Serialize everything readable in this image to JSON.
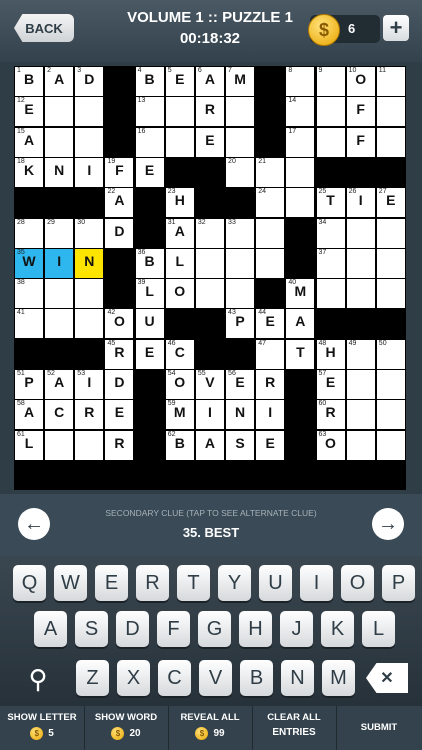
{
  "header": {
    "back_label": "BACK",
    "title": "VOLUME 1 :: PUZZLE 1",
    "timer": "00:18:32",
    "coins": "6",
    "coin_symbol": "$",
    "plus_label": "+"
  },
  "grid": {
    "rows": 14,
    "cols": 13,
    "cells": [
      {
        "r": 0,
        "c": 0,
        "n": "1",
        "l": "B"
      },
      {
        "r": 0,
        "c": 1,
        "n": "2",
        "l": "A"
      },
      {
        "r": 0,
        "c": 2,
        "n": "3",
        "l": "D"
      },
      {
        "r": 0,
        "c": 4,
        "n": "4",
        "l": "B"
      },
      {
        "r": 0,
        "c": 5,
        "n": "5",
        "l": "E"
      },
      {
        "r": 0,
        "c": 6,
        "n": "6",
        "l": "A"
      },
      {
        "r": 0,
        "c": 7,
        "n": "7",
        "l": "M"
      },
      {
        "r": 0,
        "c": 9,
        "n": "8",
        "l": ""
      },
      {
        "r": 0,
        "c": 10,
        "n": "9",
        "l": ""
      },
      {
        "r": 0,
        "c": 11,
        "n": "10",
        "l": "O"
      },
      {
        "r": 0,
        "c": 12,
        "n": "11",
        "l": ""
      },
      {
        "r": 1,
        "c": 0,
        "n": "12",
        "l": "E"
      },
      {
        "r": 1,
        "c": 1,
        "n": "",
        "l": ""
      },
      {
        "r": 1,
        "c": 2,
        "n": "",
        "l": ""
      },
      {
        "r": 1,
        "c": 4,
        "n": "13",
        "l": ""
      },
      {
        "r": 1,
        "c": 5,
        "n": "",
        "l": ""
      },
      {
        "r": 1,
        "c": 6,
        "n": "",
        "l": "R"
      },
      {
        "r": 1,
        "c": 7,
        "n": "",
        "l": ""
      },
      {
        "r": 1,
        "c": 9,
        "n": "14",
        "l": ""
      },
      {
        "r": 1,
        "c": 10,
        "n": "",
        "l": ""
      },
      {
        "r": 1,
        "c": 11,
        "n": "",
        "l": "F"
      },
      {
        "r": 1,
        "c": 12,
        "n": "",
        "l": ""
      },
      {
        "r": 2,
        "c": 0,
        "n": "15",
        "l": "A"
      },
      {
        "r": 2,
        "c": 1,
        "n": "",
        "l": ""
      },
      {
        "r": 2,
        "c": 2,
        "n": "",
        "l": ""
      },
      {
        "r": 2,
        "c": 4,
        "n": "16",
        "l": ""
      },
      {
        "r": 2,
        "c": 5,
        "n": "",
        "l": ""
      },
      {
        "r": 2,
        "c": 6,
        "n": "",
        "l": "E"
      },
      {
        "r": 2,
        "c": 7,
        "n": "",
        "l": ""
      },
      {
        "r": 2,
        "c": 9,
        "n": "17",
        "l": ""
      },
      {
        "r": 2,
        "c": 10,
        "n": "",
        "l": ""
      },
      {
        "r": 2,
        "c": 11,
        "n": "",
        "l": "F"
      },
      {
        "r": 2,
        "c": 12,
        "n": "",
        "l": ""
      },
      {
        "r": 3,
        "c": 0,
        "n": "18",
        "l": "K"
      },
      {
        "r": 3,
        "c": 1,
        "n": "",
        "l": "N"
      },
      {
        "r": 3,
        "c": 2,
        "n": "",
        "l": "I"
      },
      {
        "r": 3,
        "c": 3,
        "n": "19",
        "l": "F"
      },
      {
        "r": 3,
        "c": 4,
        "n": "",
        "l": "E"
      },
      {
        "r": 3,
        "c": 7,
        "n": "20",
        "l": ""
      },
      {
        "r": 3,
        "c": 8,
        "n": "21",
        "l": ""
      },
      {
        "r": 3,
        "c": 9,
        "n": "",
        "l": ""
      },
      {
        "r": 4,
        "c": 3,
        "n": "22",
        "l": "A"
      },
      {
        "r": 4,
        "c": 5,
        "n": "23",
        "l": "H"
      },
      {
        "r": 4,
        "c": 8,
        "n": "24",
        "l": ""
      },
      {
        "r": 4,
        "c": 9,
        "n": "",
        "l": ""
      },
      {
        "r": 4,
        "c": 10,
        "n": "25",
        "l": "T"
      },
      {
        "r": 4,
        "c": 11,
        "n": "26",
        "l": "I"
      },
      {
        "r": 4,
        "c": 12,
        "n": "27",
        "l": "E"
      },
      {
        "r": 5,
        "c": 0,
        "n": "28",
        "l": ""
      },
      {
        "r": 5,
        "c": 1,
        "n": "29",
        "l": ""
      },
      {
        "r": 5,
        "c": 2,
        "n": "30",
        "l": ""
      },
      {
        "r": 5,
        "c": 3,
        "n": "",
        "l": "D"
      },
      {
        "r": 5,
        "c": 5,
        "n": "31",
        "l": "A"
      },
      {
        "r": 5,
        "c": 6,
        "n": "32",
        "l": ""
      },
      {
        "r": 5,
        "c": 7,
        "n": "33",
        "l": ""
      },
      {
        "r": 5,
        "c": 8,
        "n": "",
        "l": ""
      },
      {
        "r": 5,
        "c": 10,
        "n": "34",
        "l": ""
      },
      {
        "r": 5,
        "c": 11,
        "n": "",
        "l": ""
      },
      {
        "r": 5,
        "c": 12,
        "n": "",
        "l": ""
      },
      {
        "r": 6,
        "c": 0,
        "n": "35",
        "l": "W",
        "s": "hl"
      },
      {
        "r": 6,
        "c": 1,
        "n": "",
        "l": "I",
        "s": "hl"
      },
      {
        "r": 6,
        "c": 2,
        "n": "",
        "l": "N",
        "s": "cur"
      },
      {
        "r": 6,
        "c": 4,
        "n": "36",
        "l": "B"
      },
      {
        "r": 6,
        "c": 5,
        "n": "",
        "l": "L"
      },
      {
        "r": 6,
        "c": 6,
        "n": "",
        "l": ""
      },
      {
        "r": 6,
        "c": 7,
        "n": "",
        "l": ""
      },
      {
        "r": 6,
        "c": 8,
        "n": "",
        "l": ""
      },
      {
        "r": 6,
        "c": 10,
        "n": "37",
        "l": ""
      },
      {
        "r": 6,
        "c": 11,
        "n": "",
        "l": ""
      },
      {
        "r": 6,
        "c": 12,
        "n": "",
        "l": ""
      },
      {
        "r": 7,
        "c": 0,
        "n": "38",
        "l": ""
      },
      {
        "r": 7,
        "c": 1,
        "n": "",
        "l": ""
      },
      {
        "r": 7,
        "c": 2,
        "n": "",
        "l": ""
      },
      {
        "r": 7,
        "c": 4,
        "n": "39",
        "l": "L"
      },
      {
        "r": 7,
        "c": 5,
        "n": "",
        "l": "O"
      },
      {
        "r": 7,
        "c": 6,
        "n": "",
        "l": ""
      },
      {
        "r": 7,
        "c": 7,
        "n": "",
        "l": ""
      },
      {
        "r": 7,
        "c": 9,
        "n": "40",
        "l": "M"
      },
      {
        "r": 7,
        "c": 10,
        "n": "",
        "l": ""
      },
      {
        "r": 7,
        "c": 11,
        "n": "",
        "l": ""
      },
      {
        "r": 7,
        "c": 12,
        "n": "",
        "l": ""
      },
      {
        "r": 8,
        "c": 0,
        "n": "41",
        "l": ""
      },
      {
        "r": 8,
        "c": 1,
        "n": "",
        "l": ""
      },
      {
        "r": 8,
        "c": 2,
        "n": "",
        "l": ""
      },
      {
        "r": 8,
        "c": 3,
        "n": "42",
        "l": "O"
      },
      {
        "r": 8,
        "c": 4,
        "n": "",
        "l": "U"
      },
      {
        "r": 8,
        "c": 7,
        "n": "43",
        "l": "P"
      },
      {
        "r": 8,
        "c": 8,
        "n": "44",
        "l": "E"
      },
      {
        "r": 8,
        "c": 9,
        "n": "",
        "l": "A"
      },
      {
        "r": 9,
        "c": 3,
        "n": "45",
        "l": "R"
      },
      {
        "r": 9,
        "c": 4,
        "n": "",
        "l": "E"
      },
      {
        "r": 9,
        "c": 5,
        "n": "46",
        "l": "C"
      },
      {
        "r": 9,
        "c": 8,
        "n": "47",
        "l": ""
      },
      {
        "r": 9,
        "c": 9,
        "n": "",
        "l": "T"
      },
      {
        "r": 9,
        "c": 10,
        "n": "48",
        "l": "H"
      },
      {
        "r": 9,
        "c": 11,
        "n": "49",
        "l": ""
      },
      {
        "r": 9,
        "c": 12,
        "n": "50",
        "l": ""
      },
      {
        "r": 10,
        "c": 0,
        "n": "51",
        "l": "P"
      },
      {
        "r": 10,
        "c": 1,
        "n": "52",
        "l": "A"
      },
      {
        "r": 10,
        "c": 2,
        "n": "53",
        "l": "I"
      },
      {
        "r": 10,
        "c": 3,
        "n": "",
        "l": "D"
      },
      {
        "r": 10,
        "c": 5,
        "n": "54",
        "l": "O"
      },
      {
        "r": 10,
        "c": 6,
        "n": "55",
        "l": "V"
      },
      {
        "r": 10,
        "c": 7,
        "n": "56",
        "l": "E"
      },
      {
        "r": 10,
        "c": 8,
        "n": "",
        "l": "R"
      },
      {
        "r": 10,
        "c": 10,
        "n": "57",
        "l": "E"
      },
      {
        "r": 10,
        "c": 11,
        "n": "",
        "l": ""
      },
      {
        "r": 10,
        "c": 12,
        "n": "",
        "l": ""
      },
      {
        "r": 11,
        "c": 0,
        "n": "58",
        "l": "A"
      },
      {
        "r": 11,
        "c": 1,
        "n": "",
        "l": "C"
      },
      {
        "r": 11,
        "c": 2,
        "n": "",
        "l": "R"
      },
      {
        "r": 11,
        "c": 3,
        "n": "",
        "l": "E"
      },
      {
        "r": 11,
        "c": 5,
        "n": "59",
        "l": "M"
      },
      {
        "r": 11,
        "c": 6,
        "n": "",
        "l": "I"
      },
      {
        "r": 11,
        "c": 7,
        "n": "",
        "l": "N"
      },
      {
        "r": 11,
        "c": 8,
        "n": "",
        "l": "I"
      },
      {
        "r": 11,
        "c": 10,
        "n": "60",
        "l": "R"
      },
      {
        "r": 11,
        "c": 11,
        "n": "",
        "l": ""
      },
      {
        "r": 11,
        "c": 12,
        "n": "",
        "l": ""
      },
      {
        "r": 12,
        "c": 0,
        "n": "61",
        "l": "L"
      },
      {
        "r": 12,
        "c": 1,
        "n": "",
        "l": ""
      },
      {
        "r": 12,
        "c": 2,
        "n": "",
        "l": ""
      },
      {
        "r": 12,
        "c": 3,
        "n": "",
        "l": "R"
      },
      {
        "r": 12,
        "c": 5,
        "n": "62",
        "l": "B"
      },
      {
        "r": 12,
        "c": 6,
        "n": "",
        "l": "A"
      },
      {
        "r": 12,
        "c": 7,
        "n": "",
        "l": "S"
      },
      {
        "r": 12,
        "c": 8,
        "n": "",
        "l": "E"
      },
      {
        "r": 12,
        "c": 10,
        "n": "63",
        "l": "O"
      },
      {
        "r": 12,
        "c": 11,
        "n": "",
        "l": ""
      },
      {
        "r": 12,
        "c": 12,
        "n": "",
        "l": ""
      }
    ]
  },
  "clue": {
    "subtitle": "SECONDARY CLUE (TAP TO SEE ALTERNATE CLUE)",
    "text": "35. BEST",
    "prev_icon": "left-arrow-icon",
    "next_icon": "right-arrow-icon"
  },
  "keyboard": {
    "row1": [
      "Q",
      "W",
      "E",
      "R",
      "T",
      "Y",
      "U",
      "I",
      "O",
      "P"
    ],
    "row2": [
      "A",
      "S",
      "D",
      "F",
      "G",
      "H",
      "J",
      "K",
      "L"
    ],
    "row3": [
      "Z",
      "X",
      "C",
      "V",
      "B",
      "N",
      "M"
    ],
    "search_icon": "magnifier-icon",
    "backspace_icon": "backspace-icon"
  },
  "bottom": {
    "show_letter": {
      "label": "SHOW LETTER",
      "cost": "5"
    },
    "show_word": {
      "label": "SHOW WORD",
      "cost": "20"
    },
    "reveal_all": {
      "label": "REVEAL ALL",
      "cost": "99"
    },
    "clear_all": {
      "label1": "CLEAR ALL",
      "label2": "ENTRIES"
    },
    "submit": {
      "label": "SUBMIT"
    }
  }
}
